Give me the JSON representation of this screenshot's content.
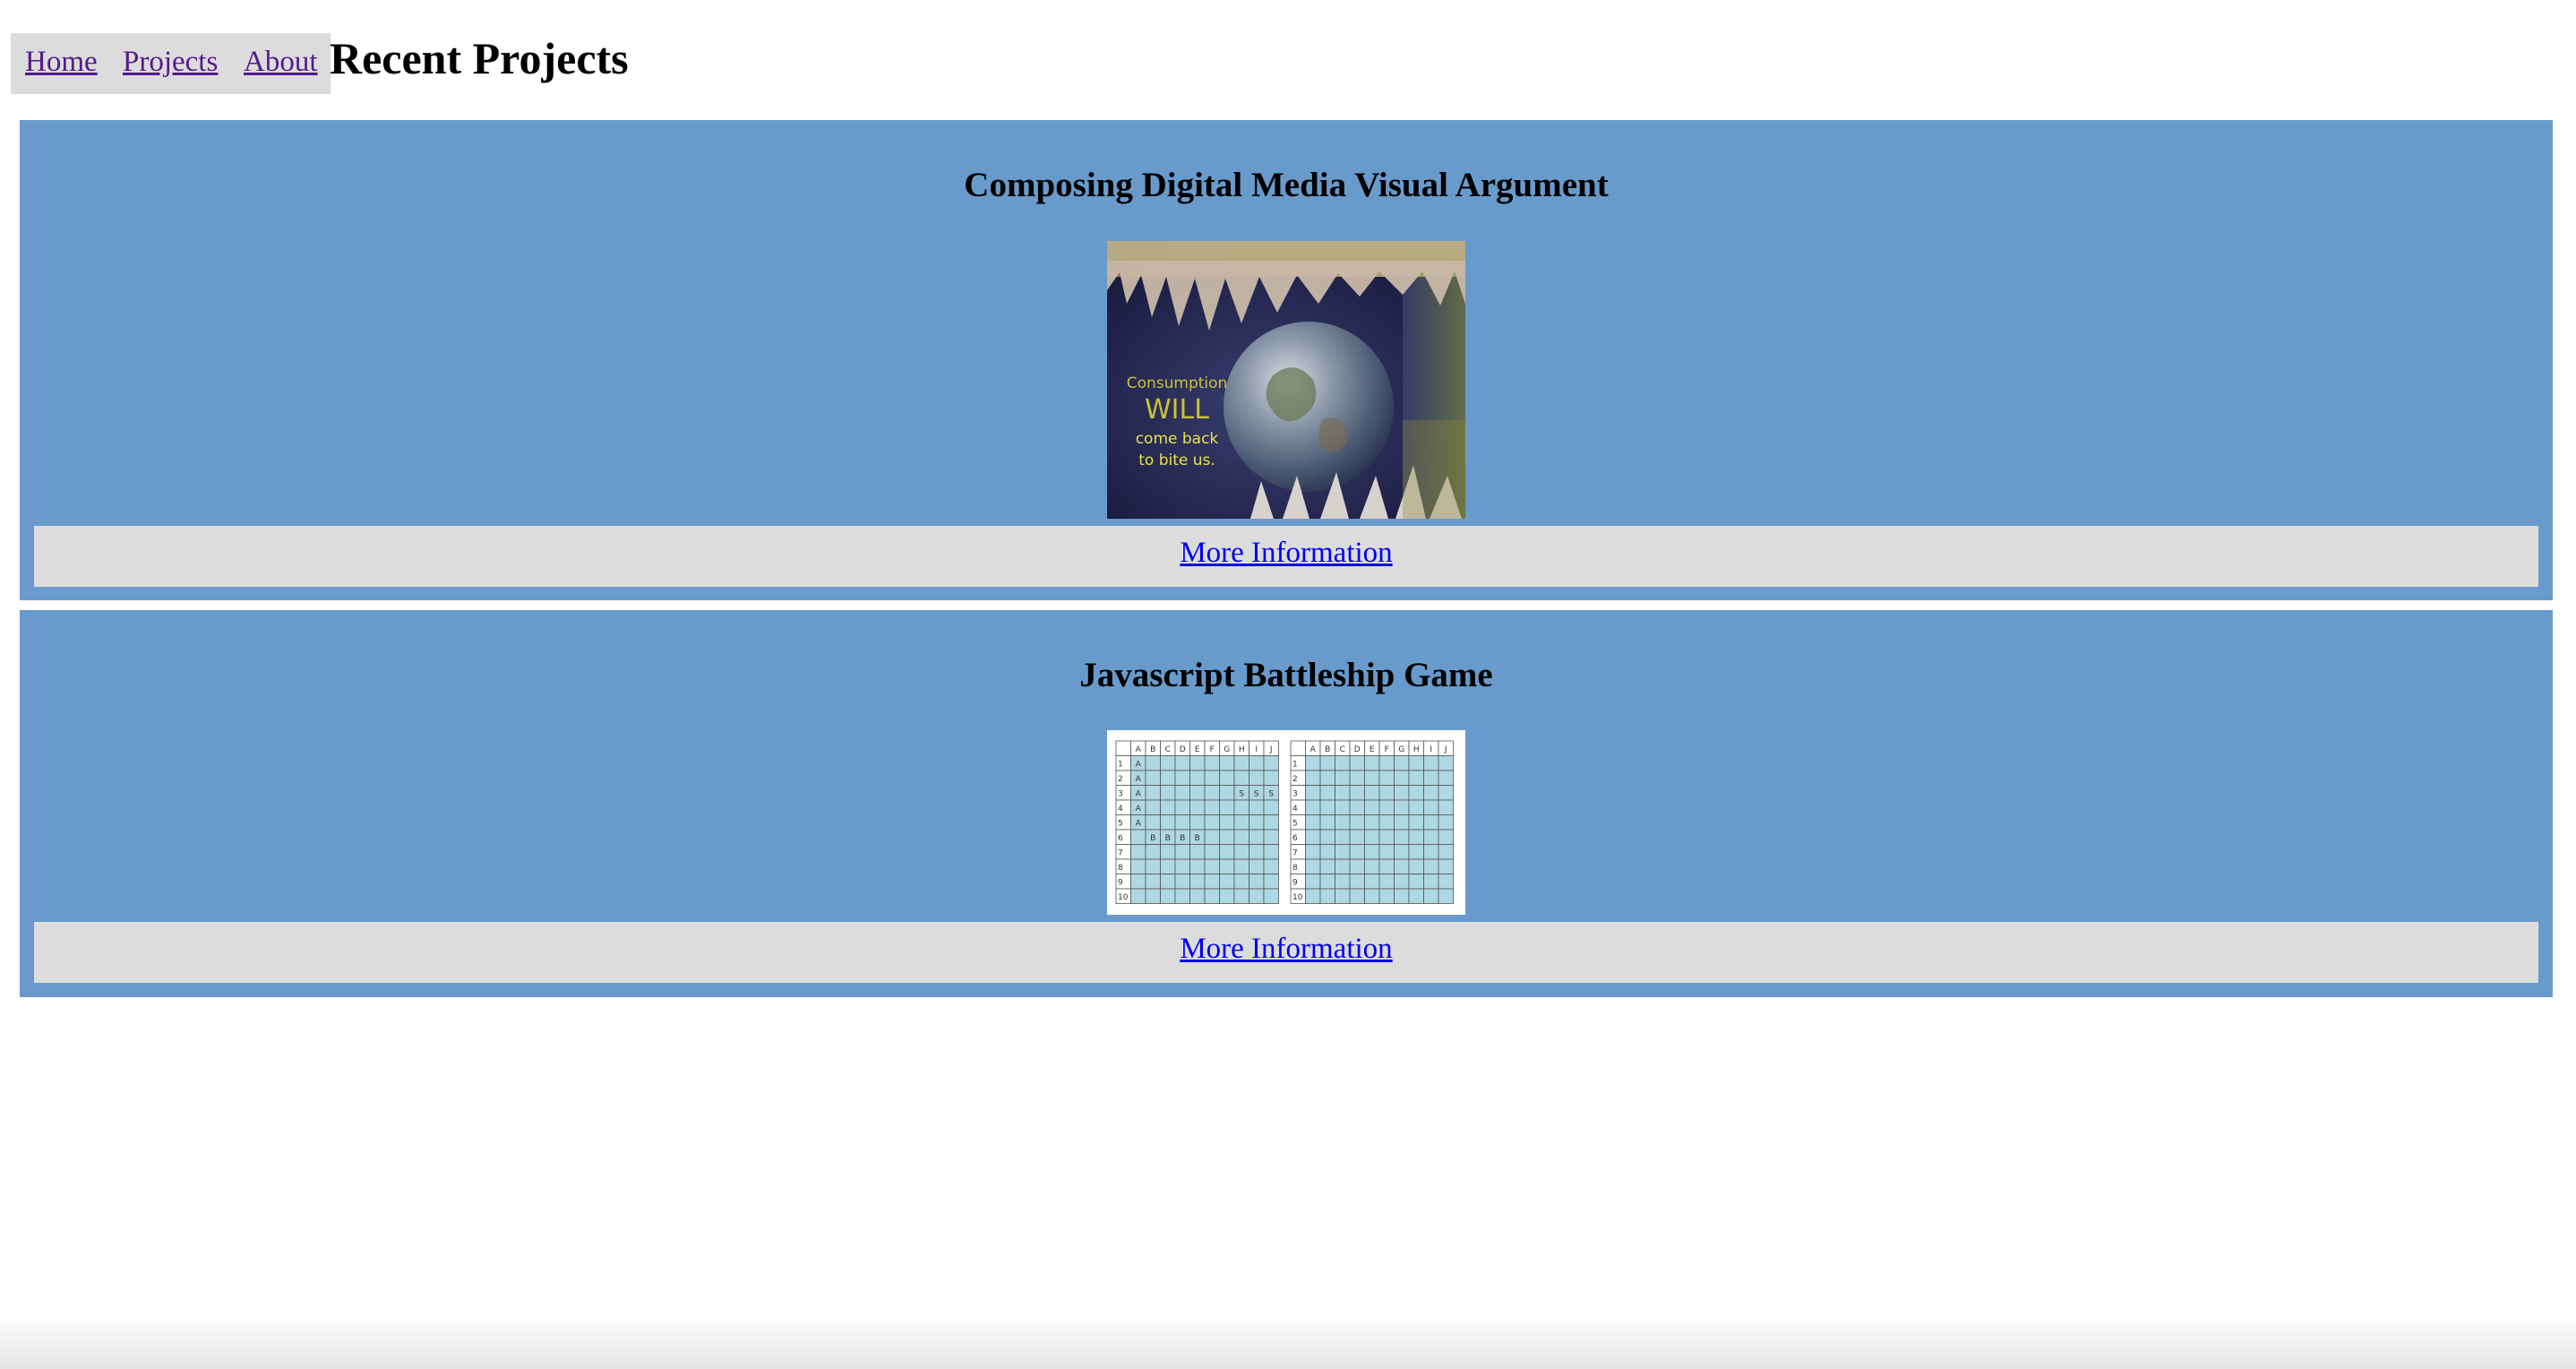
{
  "nav": {
    "items": [
      {
        "label": "Home"
      },
      {
        "label": "Projects"
      },
      {
        "label": "About"
      }
    ]
  },
  "page": {
    "title": "Recent Projects"
  },
  "projects": [
    {
      "title": "Composing Digital Media Visual Argument",
      "image_caption": {
        "line1": "Consumption",
        "line2": "WILL",
        "line3": "come back",
        "line4": "to bite us."
      },
      "more_label": "More Information"
    },
    {
      "title": "Javascript Battleship Game",
      "more_label": "More Information"
    }
  ],
  "battleship": {
    "columns": [
      "A",
      "B",
      "C",
      "D",
      "E",
      "F",
      "G",
      "H",
      "I",
      "J"
    ],
    "rows": [
      "1",
      "2",
      "3",
      "4",
      "5",
      "6",
      "7",
      "8",
      "9",
      "10"
    ],
    "ships": [
      {
        "letter": "A",
        "cells": [
          [
            "A",
            "1"
          ],
          [
            "A",
            "2"
          ],
          [
            "A",
            "3"
          ],
          [
            "A",
            "4"
          ],
          [
            "A",
            "5"
          ]
        ]
      },
      {
        "letter": "B",
        "cells": [
          [
            "B",
            "6"
          ],
          [
            "C",
            "6"
          ],
          [
            "D",
            "6"
          ],
          [
            "E",
            "6"
          ]
        ]
      },
      {
        "letter": "S",
        "cells": [
          [
            "H",
            "3"
          ],
          [
            "I",
            "3"
          ],
          [
            "J",
            "3"
          ]
        ]
      }
    ]
  },
  "colors": {
    "card_bg": "#689bcb",
    "nav_bg": "#dcdcdc",
    "visited_link": "#551a8b",
    "link": "#0000ee",
    "grid_cell": "#aed8e3",
    "caption_yellow": "#c8c23a"
  }
}
